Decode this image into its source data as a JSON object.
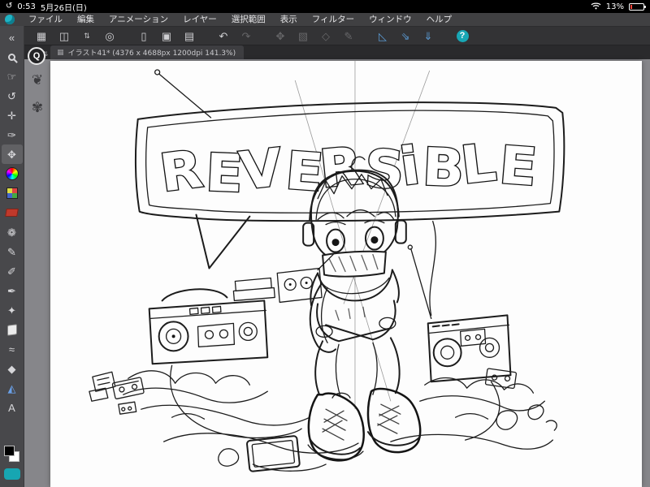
{
  "status_bar": {
    "time": "0:53",
    "date": "5月26日(日)",
    "battery_percent": "13%",
    "orientation_icon": "↺"
  },
  "menu_bar": {
    "items": [
      "ファイル",
      "編集",
      "アニメーション",
      "レイヤー",
      "選択範囲",
      "表示",
      "フィルター",
      "ウィンドウ",
      "ヘルプ"
    ]
  },
  "toolbar": {
    "icons": [
      {
        "name": "workspace-grid-icon",
        "glyph": "▦"
      },
      {
        "name": "touch-panel-icon",
        "glyph": "◫"
      },
      {
        "name": "view-stepper-icon",
        "glyph": "⇅",
        "cls": "small"
      },
      {
        "name": "clip-studio-icon",
        "glyph": "◎"
      },
      {
        "name": "new-canvas-icon",
        "glyph": "▯",
        "cls": "gap"
      },
      {
        "name": "export-icon",
        "glyph": "▣"
      },
      {
        "name": "paper-stepper-icon",
        "glyph": "▤"
      },
      {
        "name": "undo-icon",
        "glyph": "↶",
        "cls": "gap"
      },
      {
        "name": "redo-icon",
        "glyph": "↷",
        "cls": "dim"
      },
      {
        "name": "transform-icon",
        "glyph": "✥",
        "cls": "gap dim"
      },
      {
        "name": "marquee-icon",
        "glyph": "▧",
        "cls": "dim"
      },
      {
        "name": "clear-icon",
        "glyph": "◇",
        "cls": "dim"
      },
      {
        "name": "edit-pen-icon",
        "glyph": "✎",
        "cls": "dim"
      },
      {
        "name": "ruler-pen-icon",
        "glyph": "◺",
        "cls": "gap blue"
      },
      {
        "name": "snap-arrow-icon",
        "glyph": "⇘",
        "cls": "blue"
      },
      {
        "name": "download-arrow-icon",
        "glyph": "⇓",
        "cls": "blue"
      },
      {
        "name": "help-icon",
        "glyph": "?",
        "cls": "gap teal"
      }
    ]
  },
  "tab_bar": {
    "tab_title": "イラスト41* (4376 x 4688px 1200dpi 141.3%)",
    "grid_icon": "▦",
    "stepper_icon": "⇅"
  },
  "tool_panel": {
    "tools": [
      {
        "name": "collapse-panel-icon",
        "glyph": "«"
      },
      {
        "name": "zoom-tool",
        "glyph": "",
        "cls": "magnifier"
      },
      {
        "name": "hand-tool",
        "glyph": "☞"
      },
      {
        "name": "rotate-canvas-tool",
        "glyph": "↺"
      },
      {
        "name": "operation-tool",
        "glyph": "✛"
      },
      {
        "name": "eyedropper-tool",
        "glyph": "✑"
      },
      {
        "name": "move-tool",
        "glyph": "✥",
        "cls": "selected"
      },
      {
        "name": "color-wheel",
        "glyph": "",
        "cls": "wheel"
      },
      {
        "name": "color-set",
        "glyph": "",
        "cls": "swatchgrid"
      },
      {
        "name": "approx-color",
        "glyph": "",
        "cls": "redchip"
      },
      {
        "name": "decoration-tool",
        "glyph": "❁"
      },
      {
        "name": "pen-tool",
        "glyph": "✎"
      },
      {
        "name": "pencil-tool",
        "glyph": "✐"
      },
      {
        "name": "brush-tool",
        "glyph": "✒"
      },
      {
        "name": "airbrush-tool",
        "glyph": "✦"
      },
      {
        "name": "eraser-tool",
        "glyph": "",
        "cls": "eraser"
      },
      {
        "name": "blend-tool",
        "glyph": "≈"
      },
      {
        "name": "fill-tool",
        "glyph": "◆"
      },
      {
        "name": "figure-tool",
        "glyph": "◭",
        "cls": "blue"
      },
      {
        "name": "text-tool",
        "glyph": "A"
      }
    ],
    "foreground_color": "#000000",
    "background_color": "#ffffff"
  },
  "quick_access": {
    "launcher_label": "Q",
    "stamp1": "❦",
    "stamp2": "✾"
  },
  "canvas": {
    "artwork_title_text": "REVERSiBLE"
  },
  "colors": {
    "accent_blue": "#5b9bd5",
    "accent_teal": "#18a7b5",
    "battery_low": "#ff453a"
  }
}
